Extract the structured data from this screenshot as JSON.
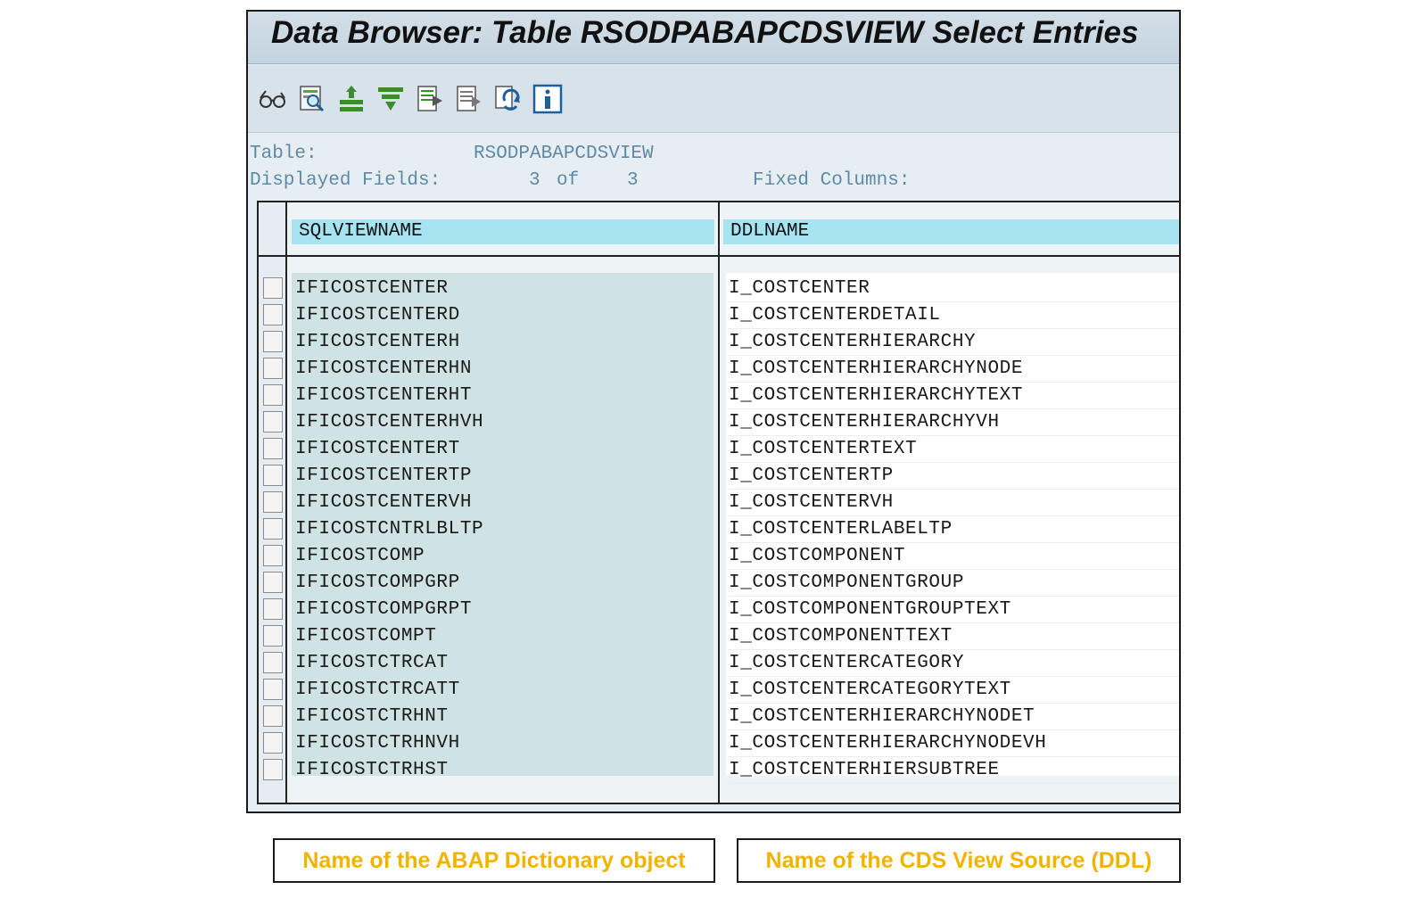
{
  "window": {
    "title": "Data Browser: Table RSODPABAPCDSVIEW Select Entries"
  },
  "toolbar": {
    "buttons": [
      {
        "name": "glasses-icon"
      },
      {
        "name": "detail-search-icon"
      },
      {
        "name": "sort-ascending-icon"
      },
      {
        "name": "filter-icon"
      },
      {
        "name": "export-icon"
      },
      {
        "name": "list-output-icon"
      },
      {
        "name": "refresh-icon"
      },
      {
        "name": "info-icon"
      }
    ]
  },
  "info": {
    "table_label": "Table:",
    "table_value": "RSODPABAPCDSVIEW",
    "fields_label": "Displayed Fields:",
    "fields_shown": "3",
    "fields_of": "of",
    "fields_total": "3",
    "fixed_label": "Fixed Columns:"
  },
  "grid": {
    "columns": [
      "SQLVIEWNAME",
      "DDLNAME"
    ],
    "rows": [
      [
        "IFICOSTCENTER",
        "I_COSTCENTER"
      ],
      [
        "IFICOSTCENTERD",
        "I_COSTCENTERDETAIL"
      ],
      [
        "IFICOSTCENTERH",
        "I_COSTCENTERHIERARCHY"
      ],
      [
        "IFICOSTCENTERHN",
        "I_COSTCENTERHIERARCHYNODE"
      ],
      [
        "IFICOSTCENTERHT",
        "I_COSTCENTERHIERARCHYTEXT"
      ],
      [
        "IFICOSTCENTERHVH",
        "I_COSTCENTERHIERARCHYVH"
      ],
      [
        "IFICOSTCENTERT",
        "I_COSTCENTERTEXT"
      ],
      [
        "IFICOSTCENTERTP",
        "I_COSTCENTERTP"
      ],
      [
        "IFICOSTCENTERVH",
        "I_COSTCENTERVH"
      ],
      [
        "IFICOSTCNTRLBLTP",
        "I_COSTCENTERLABELTP"
      ],
      [
        "IFICOSTCOMP",
        "I_COSTCOMPONENT"
      ],
      [
        "IFICOSTCOMPGRP",
        "I_COSTCOMPONENTGROUP"
      ],
      [
        "IFICOSTCOMPGRPT",
        "I_COSTCOMPONENTGROUPTEXT"
      ],
      [
        "IFICOSTCOMPT",
        "I_COSTCOMPONENTTEXT"
      ],
      [
        "IFICOSTCTRCAT",
        "I_COSTCENTERCATEGORY"
      ],
      [
        "IFICOSTCTRCATT",
        "I_COSTCENTERCATEGORYTEXT"
      ],
      [
        "IFICOSTCTRHNT",
        "I_COSTCENTERHIERARCHYNODET"
      ],
      [
        "IFICOSTCTRHNVH",
        "I_COSTCENTERHIERARCHYNODEVH"
      ],
      [
        "IFICOSTCTRHST",
        "I_COSTCENTERHIERSUBTREE"
      ]
    ]
  },
  "callouts": {
    "left": "Name of the ABAP Dictionary object",
    "right": "Name of the CDS View Source (DDL)"
  },
  "colors": {
    "header_cell": "#a6e4f2",
    "key_column": "#cfe2e4",
    "info_text": "#5f8aa3",
    "callout_text": "#f0b400"
  }
}
